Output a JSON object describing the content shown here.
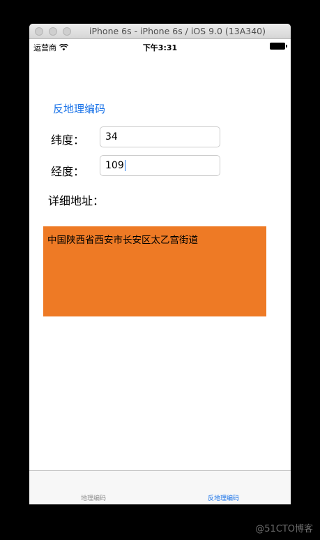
{
  "window": {
    "title": "iPhone 6s - iPhone 6s / iOS 9.0 (13A340)"
  },
  "status_bar": {
    "carrier": "运营商",
    "time": "下午3:31",
    "wifi_icon": "wifi-icon",
    "battery_icon": "battery-full-icon"
  },
  "nav": {
    "reverse_geocode_button": "反地理编码"
  },
  "form": {
    "latitude_label": "纬度：",
    "latitude_value": "34",
    "longitude_label": "经度：",
    "longitude_value": "109",
    "address_label": "详细地址："
  },
  "result": {
    "address_text": "中国陕西省西安市长安区太乙宫街道",
    "background_color": "#ee7a25"
  },
  "tab_bar": {
    "tabs": [
      {
        "label": "地理编码",
        "active": false
      },
      {
        "label": "反地理编码",
        "active": true
      }
    ]
  },
  "watermark": "@51CTO博客",
  "colors": {
    "accent": "#1a73e8"
  }
}
